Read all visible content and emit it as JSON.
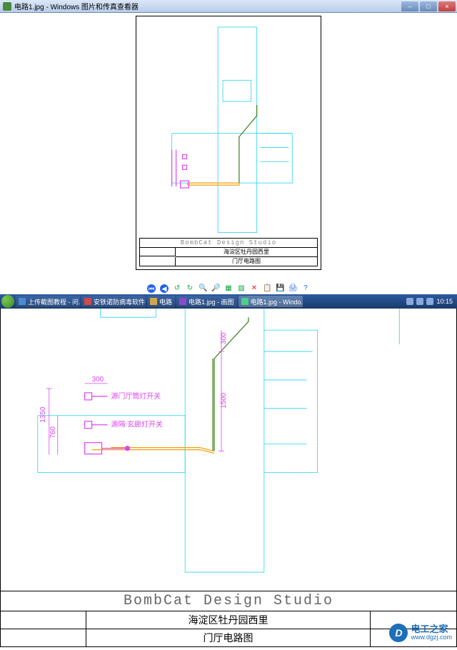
{
  "window": {
    "title": "电路1.jpg - Windows 图片和传真查看器"
  },
  "toolbar_icons": [
    "prev",
    "next",
    "rotate-ccw",
    "rotate-cw",
    "zoom-out",
    "zoom-in",
    "fit",
    "actual",
    "delete",
    "copy",
    "save",
    "print",
    "help"
  ],
  "taskbar": {
    "items": [
      {
        "label": "上传截图教程 - 问..."
      },
      {
        "label": "安铁诺防病毒软件"
      },
      {
        "label": "电路"
      },
      {
        "label": "电路1.jpg - 画图"
      },
      {
        "label": "电路1.jpg - Windo..."
      }
    ],
    "time": "10:15"
  },
  "small_doc": {
    "studio": "BombCat Design Studio",
    "row1": "海淀区牡丹园西里",
    "row2": "门厅电路图"
  },
  "drawing": {
    "dims": {
      "h300": "300",
      "v1500": "1500",
      "h300b": "300",
      "v1350": "1350",
      "v760": "760"
    },
    "labels": {
      "l1": "源门厅筒灯开关",
      "l2": "源隔:玄廊灯开关"
    }
  },
  "bottom_block": {
    "studio": "BombCat Design Studio",
    "row1": "海淀区牡丹园西里",
    "row2": "门厅电路图"
  },
  "watermark": {
    "main": "电工之家",
    "url": "www.dgzj.com"
  }
}
